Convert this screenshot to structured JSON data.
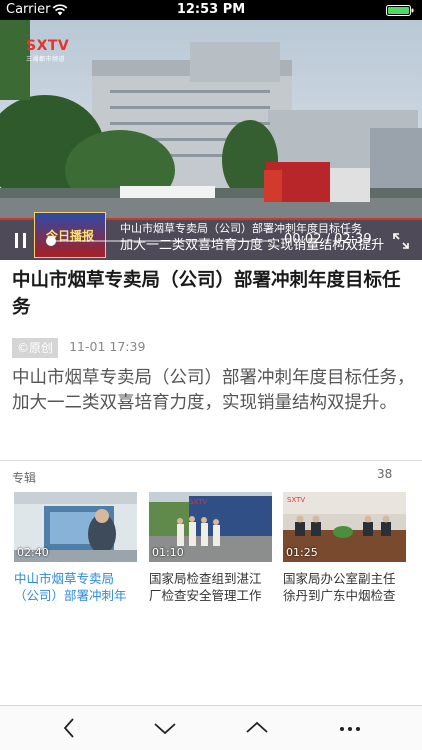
{
  "status_bar": {
    "carrier": "Carrier",
    "time": "12:53 PM",
    "wifi_icon": "wifi-icon",
    "battery_icon": "battery-icon"
  },
  "video": {
    "watermark": "SXTV",
    "watermark_sub": "三湘都市频道",
    "news_logo": "今日播报",
    "caption_line1": "中山市烟草专卖局（公司）部署冲刺年度目标任务",
    "caption_line2": "加大一二类双喜培育力度  实现销量结构双提升",
    "current_time": "00:02",
    "duration": "02:39",
    "progress": 0.012,
    "pause_icon": "pause-icon",
    "fullscreen_icon": "fullscreen-icon"
  },
  "article": {
    "title": "中山市烟草专卖局（公司）部署冲刺年度目标任务",
    "badge": "©原创",
    "date": "11-01 17:39",
    "summary": "中山市烟草专卖局（公司）部署冲刺年度目标任务，加大一二类双喜培育力度，实现销量结构双提升。"
  },
  "album": {
    "label": "专辑",
    "count": "38",
    "items": [
      {
        "duration": "02:40",
        "title": "中山市烟草专卖局（公司）部署冲刺年度目标",
        "active": true
      },
      {
        "duration": "01:10",
        "title": "国家局检查组到湛江厂检查安全管理工作",
        "active": false
      },
      {
        "duration": "01:25",
        "title": "国家局办公室副主任徐丹到广东中烟检查保密",
        "active": false
      }
    ]
  },
  "toolbar": {
    "back_icon": "chevron-left-icon",
    "next_icon": "chevron-down-icon",
    "prev_icon": "chevron-up-icon",
    "more_icon": "more-icon"
  },
  "colors": {
    "accent": "#2f8ad8",
    "status_bar": "#000000",
    "battery": "#4cd964"
  }
}
